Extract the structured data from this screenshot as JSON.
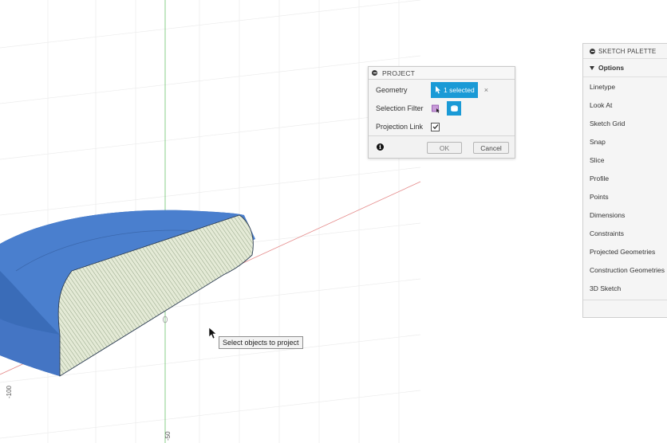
{
  "dialog": {
    "title": "PROJECT",
    "geometry_label": "Geometry",
    "geometry_value": "1 selected",
    "clear_symbol": "×",
    "selection_filter_label": "Selection Filter",
    "projection_link_label": "Projection Link",
    "projection_link_checked": true,
    "ok_label": "OK",
    "cancel_label": "Cancel",
    "info_symbol": "i"
  },
  "tooltip": {
    "text": "Select objects to project"
  },
  "canvas": {
    "axis_label_left": "-100",
    "axis_label_bottom": "-50"
  },
  "palette": {
    "title": "SKETCH PALETTE",
    "options_label": "Options",
    "items": [
      "Linetype",
      "Look At",
      "Sketch Grid",
      "Snap",
      "Slice",
      "Profile",
      "Points",
      "Dimensions",
      "Constraints",
      "Projected Geometries",
      "Construction Geometries",
      "3D Sketch"
    ]
  },
  "colors": {
    "accent": "#1a9ad6",
    "body_blue": "#4a7fce",
    "body_blue_dark": "#3a6cb8",
    "section_face": "#dfe6cf",
    "x_axis": "#e58a8a",
    "y_axis": "#6cc36c"
  }
}
